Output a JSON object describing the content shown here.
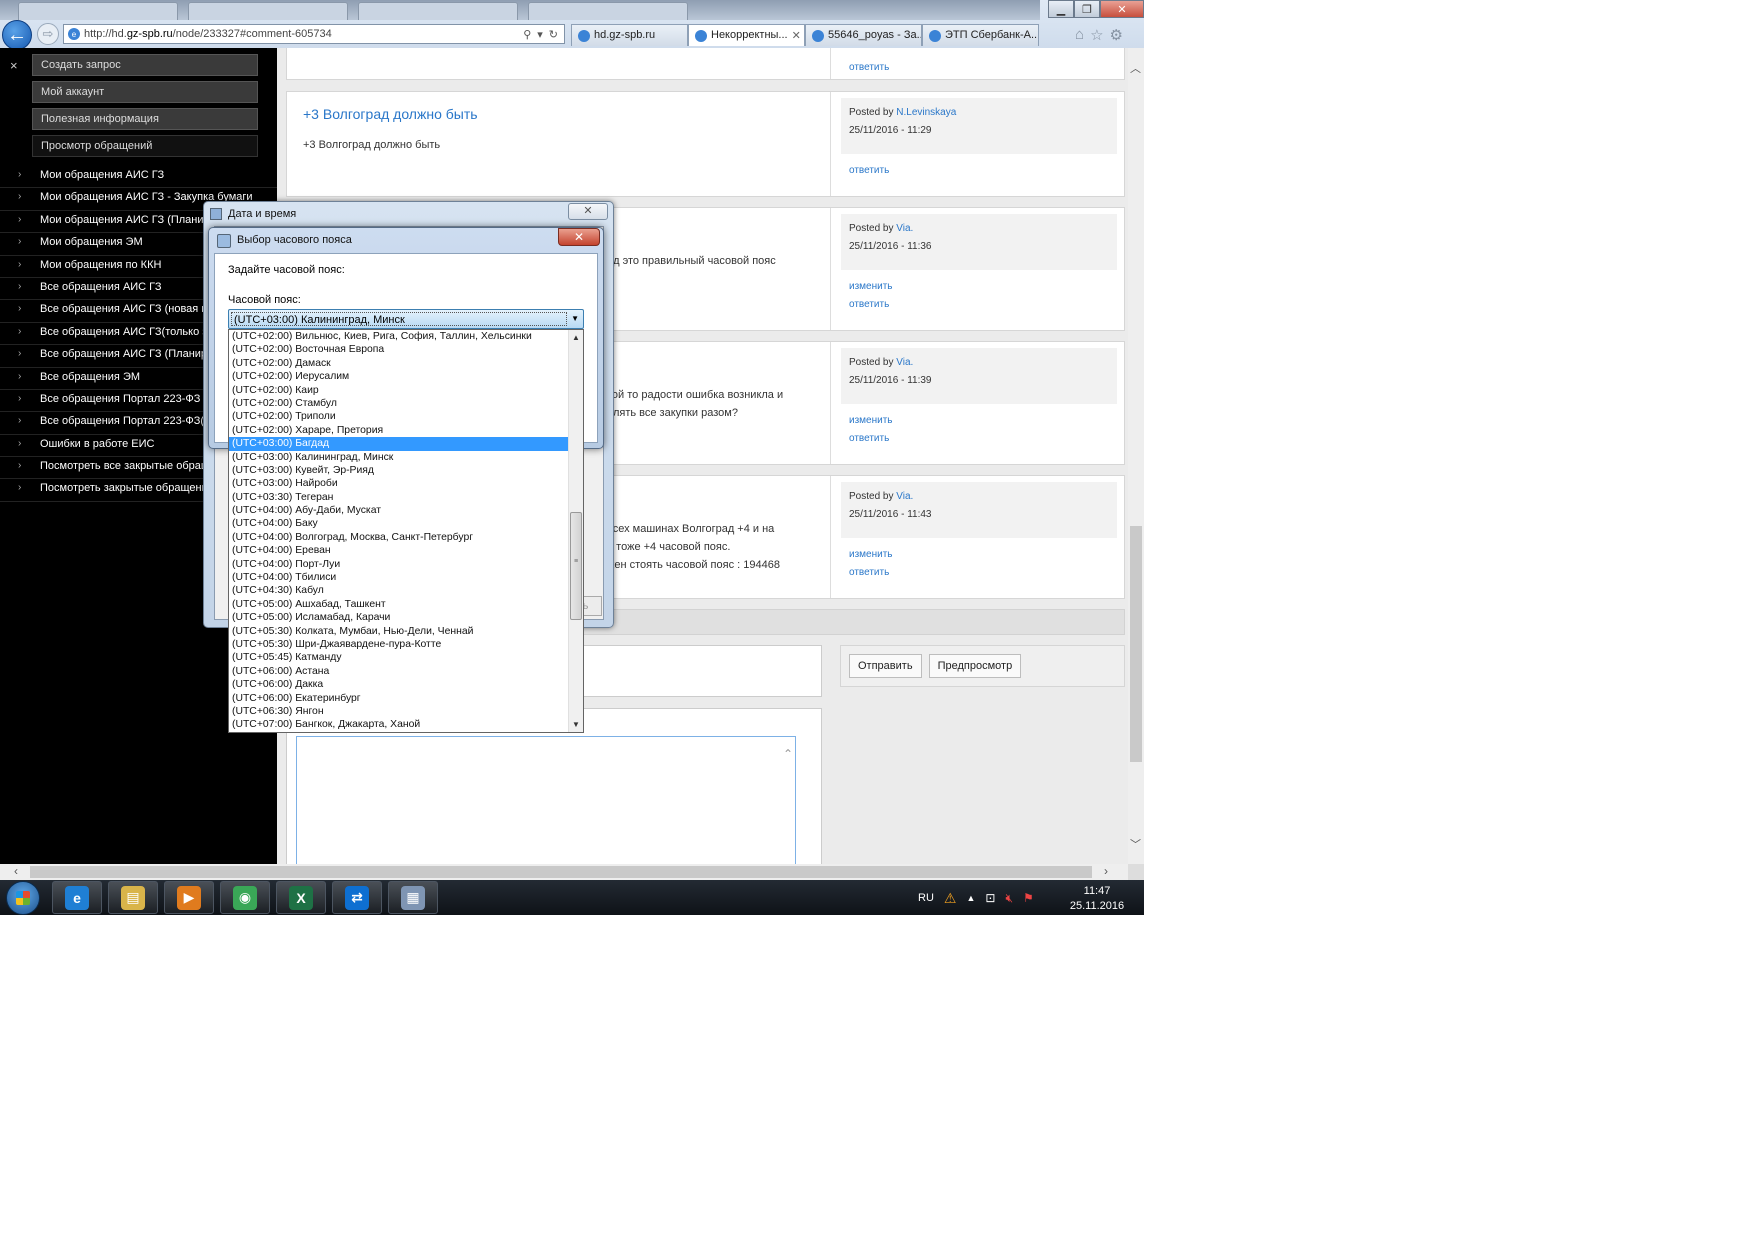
{
  "browser": {
    "url_prefix": "http://hd.",
    "url_domain": "gz-spb.ru",
    "url_suffix": "/node/233327#comment-605734",
    "tabs": [
      {
        "label": "hd.gz-spb.ru",
        "active": false
      },
      {
        "label": "Некорректны...",
        "active": true
      },
      {
        "label": "55646_poyas - За...",
        "active": false
      },
      {
        "label": "ЭТП Сбербанк-А...",
        "active": false
      }
    ]
  },
  "sidebar": {
    "close_glyph": "×",
    "top_buttons": [
      "Создать запрос",
      "Мой аккаунт",
      "Полезная информация",
      "Просмотр обращений"
    ],
    "items": [
      "Мои обращения АИС ГЗ",
      "Мои обращения АИС ГЗ - Закупка бумаги",
      "Мои обращения АИС ГЗ (Планирование)",
      "Мои обращения ЭМ",
      "Мои обращения по ККН",
      "Все обращения АИС ГЗ",
      "Все обращения АИС ГЗ (новая платформа)",
      "Все обращения АИС ГЗ(только закрытые)",
      "Все обращения АИС ГЗ (Планирование)",
      "Все обращения ЭМ",
      "Все обращения Портал 223-ФЗ",
      "Все обращения Портал 223-ФЗ(только закрытые)",
      "Ошибки в работе ЕИС",
      "Посмотреть все закрытые обращения",
      "Посмотреть закрытые обращения ЭМ"
    ]
  },
  "posts": [
    {
      "title": "",
      "text": "",
      "posted_by_prefix": "",
      "author": "",
      "date": "",
      "actions": [
        "ответить"
      ]
    },
    {
      "title": "+3 Волгоград должно быть",
      "text": "+3 Волгоград должно быть",
      "posted_by_prefix": "Posted by",
      "author": "N.Levinskaya",
      "date": "25/11/2016 - 11:29",
      "actions": [
        "ответить"
      ]
    },
    {
      "title": "",
      "text": "ад это правильный часовой пояс",
      "posted_by_prefix": "Posted by",
      "author": "Via.",
      "date": "25/11/2016 - 11:36",
      "actions": [
        "изменить",
        "ответить"
      ]
    },
    {
      "title": "",
      "text": "кой то радости ошибка возникла и\nялять все закупки разом?",
      "posted_by_prefix": "Posted by",
      "author": "Via.",
      "date": "25/11/2016 - 11:39",
      "actions": [
        "изменить",
        "ответить"
      ]
    },
    {
      "title": "",
      "text": "всех машинах Волгоград +4 и на\nо тоже +4 часовой пояс.\nжен стоять часовой пояс : 194468",
      "posted_by_prefix": "Posted by",
      "author": "Via.",
      "date": "25/11/2016 - 11:43",
      "actions": [
        "изменить",
        "ответить"
      ]
    }
  ],
  "form": {
    "submit_label": "Отправить",
    "preview_label": "Предпросмотр"
  },
  "dialog_datetime": {
    "title": "Дата и время",
    "close_glyph": "✕",
    "hint_button": "ть"
  },
  "dialog_timezone": {
    "title": "Выбор часового пояса",
    "close_glyph": "✕",
    "prompt": "Задайте часовой пояс:",
    "field_label": "Часовой пояс:",
    "selected_value": "(UTC+03:00) Калининград, Минск",
    "highlighted_index": 8,
    "options": [
      "(UTC+02:00) Вильнюс, Киев, Рига, София, Таллин, Хельсинки",
      "(UTC+02:00) Восточная Европа",
      "(UTC+02:00) Дамаск",
      "(UTC+02:00) Иерусалим",
      "(UTC+02:00) Каир",
      "(UTC+02:00) Стамбул",
      "(UTC+02:00) Триполи",
      "(UTC+02:00) Хараре, Претория",
      "(UTC+03:00) Багдад",
      "(UTC+03:00) Калининград, Минск",
      "(UTC+03:00) Кувейт, Эр-Рияд",
      "(UTC+03:00) Найроби",
      "(UTC+03:30) Тегеран",
      "(UTC+04:00) Абу-Даби, Мускат",
      "(UTC+04:00) Баку",
      "(UTC+04:00) Волгоград, Москва, Санкт-Петербург",
      "(UTC+04:00) Ереван",
      "(UTC+04:00) Порт-Луи",
      "(UTC+04:00) Тбилиси",
      "(UTC+04:30) Кабул",
      "(UTC+05:00) Ашхабад, Ташкент",
      "(UTC+05:00) Исламабад, Карачи",
      "(UTC+05:30) Колката, Мумбаи, Нью-Дели, Ченнай",
      "(UTC+05:30) Шри-Джаявардене-пура-Котте",
      "(UTC+05:45) Катманду",
      "(UTC+06:00) Астана",
      "(UTC+06:00) Дакка",
      "(UTC+06:00) Екатеринбург",
      "(UTC+06:30) Янгон",
      "(UTC+07:00) Бангкок, Джакарта, Ханой"
    ]
  },
  "taskbar": {
    "apps": [
      {
        "icon": "internet-explorer-icon",
        "glyph": "e",
        "color": "#1f7fd4"
      },
      {
        "icon": "file-explorer-icon",
        "glyph": "▤",
        "color": "#d9b44a"
      },
      {
        "icon": "media-player-icon",
        "glyph": "▶",
        "color": "#e07b1e"
      },
      {
        "icon": "chrome-icon",
        "glyph": "◉",
        "color": "#3aa757"
      },
      {
        "icon": "excel-icon",
        "glyph": "X",
        "color": "#1e7145"
      },
      {
        "icon": "teamviewer-icon",
        "glyph": "⇄",
        "color": "#0e6fd1"
      },
      {
        "icon": "datetime-control-icon",
        "glyph": "▦",
        "color": "#7f95b3"
      }
    ],
    "language": "RU",
    "time": "11:47",
    "date": "25.11.2016"
  },
  "colors": {
    "link": "#2a77c9",
    "selection": "#3399ff",
    "back_button": "#1558b0"
  }
}
